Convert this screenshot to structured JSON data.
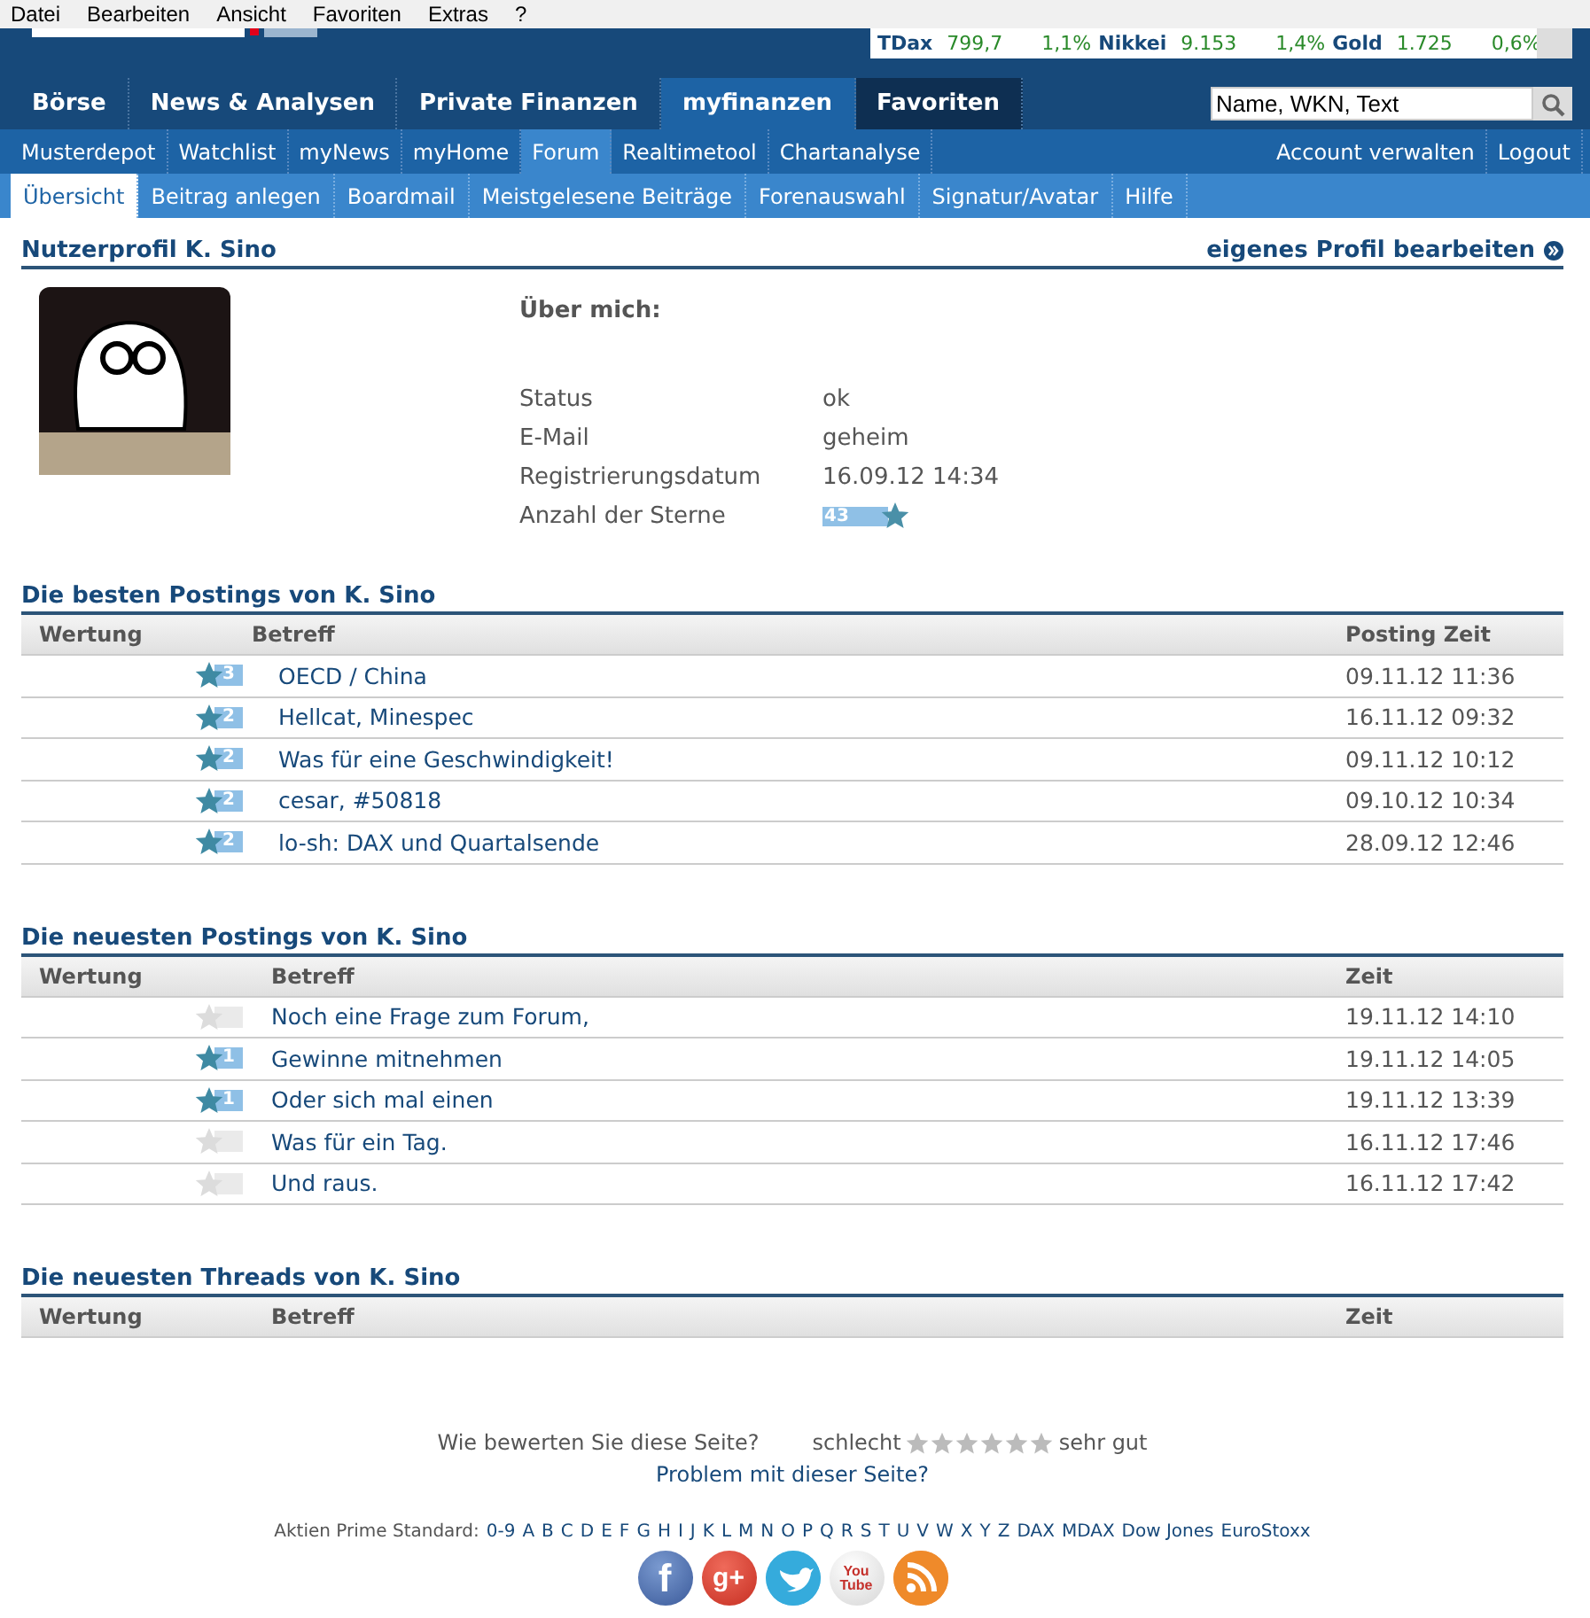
{
  "menu_bar": [
    "Datei",
    "Bearbeiten",
    "Ansicht",
    "Favoriten",
    "Extras",
    "?"
  ],
  "ticker": [
    {
      "name": "TDax",
      "value": "799,7",
      "change": "1,1%"
    },
    {
      "name": "Nikkei",
      "value": "9.153",
      "change": "1,4%"
    },
    {
      "name": "Gold",
      "value": "1.725",
      "change": "0,6%"
    }
  ],
  "main_nav": [
    {
      "label": "Börse",
      "selected": false
    },
    {
      "label": "News & Analysen",
      "selected": false
    },
    {
      "label": "Private Finanzen",
      "selected": false
    },
    {
      "label": "myfinanzen",
      "selected": true
    },
    {
      "label": "Favoriten",
      "selected": false
    }
  ],
  "search": {
    "value": "Name, WKN, Text"
  },
  "sub_nav": [
    {
      "label": "Musterdepot",
      "selected": false
    },
    {
      "label": "Watchlist",
      "selected": false
    },
    {
      "label": "myNews",
      "selected": false
    },
    {
      "label": "myHome",
      "selected": false
    },
    {
      "label": "Forum",
      "selected": true
    },
    {
      "label": "Realtimetool",
      "selected": false
    },
    {
      "label": "Chartanalyse",
      "selected": false
    }
  ],
  "account_links": [
    "Account verwalten",
    "Logout"
  ],
  "tabs": [
    {
      "label": "Übersicht",
      "selected": true
    },
    {
      "label": "Beitrag anlegen",
      "selected": false
    },
    {
      "label": "Boardmail",
      "selected": false
    },
    {
      "label": "Meistgelesene Beiträge",
      "selected": false
    },
    {
      "label": "Forenauswahl",
      "selected": false
    },
    {
      "label": "Signatur/Avatar",
      "selected": false
    },
    {
      "label": "Hilfe",
      "selected": false
    }
  ],
  "profile": {
    "title": "Nutzerprofil K. Sino",
    "edit_link": "eigenes Profil bearbeiten",
    "about_label": "Über mich:",
    "fields": [
      {
        "label": "Status",
        "value": "ok"
      },
      {
        "label": "E-Mail",
        "value": "geheim"
      },
      {
        "label": "Registrierungsdatum",
        "value": "16.09.12 14:34"
      },
      {
        "label": "Anzahl der Sterne",
        "value": "43",
        "kind": "stars"
      }
    ]
  },
  "sections": [
    {
      "title": "Die besten Postings von K. Sino",
      "columns": [
        "Wertung",
        "Betreff",
        "Posting Zeit"
      ],
      "rows": [
        {
          "rated": true,
          "score": "3",
          "subject": "OECD / China",
          "time": "09.11.12 11:36"
        },
        {
          "rated": true,
          "score": "2",
          "subject": "Hellcat, Minespec",
          "time": "16.11.12 09:32"
        },
        {
          "rated": true,
          "score": "2",
          "subject": "Was für eine Geschwindigkeit!",
          "time": "09.11.12 10:12"
        },
        {
          "rated": true,
          "score": "2",
          "subject": "cesar, #50818",
          "time": "09.10.12 10:34"
        },
        {
          "rated": true,
          "score": "2",
          "subject": "lo-sh: DAX und Quartalsende",
          "time": "28.09.12 12:46"
        }
      ]
    },
    {
      "title": "Die neuesten Postings von K. Sino",
      "columns": [
        "Wertung",
        "Betreff",
        "Zeit"
      ],
      "rows": [
        {
          "rated": false,
          "subject": "Noch eine Frage zum Forum,",
          "time": "19.11.12 14:10"
        },
        {
          "rated": true,
          "score": "1",
          "subject": "Gewinne mitnehmen",
          "time": "19.11.12 14:05"
        },
        {
          "rated": true,
          "score": "1",
          "subject": "Oder sich mal einen",
          "time": "19.11.12 13:39"
        },
        {
          "rated": false,
          "subject": "Was für ein Tag.",
          "time": "16.11.12 17:46"
        },
        {
          "rated": false,
          "subject": "Und raus.",
          "time": "16.11.12 17:42"
        }
      ]
    },
    {
      "title": "Die neuesten Threads von K. Sino",
      "columns": [
        "Wertung",
        "Betreff",
        "Zeit"
      ]
    }
  ],
  "page_rating": {
    "question": "Wie bewerten Sie diese Seite?",
    "low": "schlecht",
    "high": "sehr gut",
    "stars": 0,
    "problem_link": "Problem mit dieser Seite?"
  },
  "index": {
    "label": "Aktien Prime Standard:",
    "links": [
      "0-9",
      "A",
      "B",
      "C",
      "D",
      "E",
      "F",
      "G",
      "H",
      "I",
      "J",
      "K",
      "L",
      "M",
      "N",
      "O",
      "P",
      "Q",
      "R",
      "S",
      "T",
      "U",
      "V",
      "W",
      "X",
      "Y",
      "Z",
      "DAX",
      "MDAX",
      "Dow Jones",
      "EuroStoxx"
    ]
  },
  "social": [
    {
      "kind": "facebook",
      "glyph": "f"
    },
    {
      "kind": "google",
      "glyph": "g+"
    },
    {
      "kind": "twitter"
    },
    {
      "kind": "youtube",
      "glyph": "You Tube"
    },
    {
      "kind": "rss"
    }
  ]
}
